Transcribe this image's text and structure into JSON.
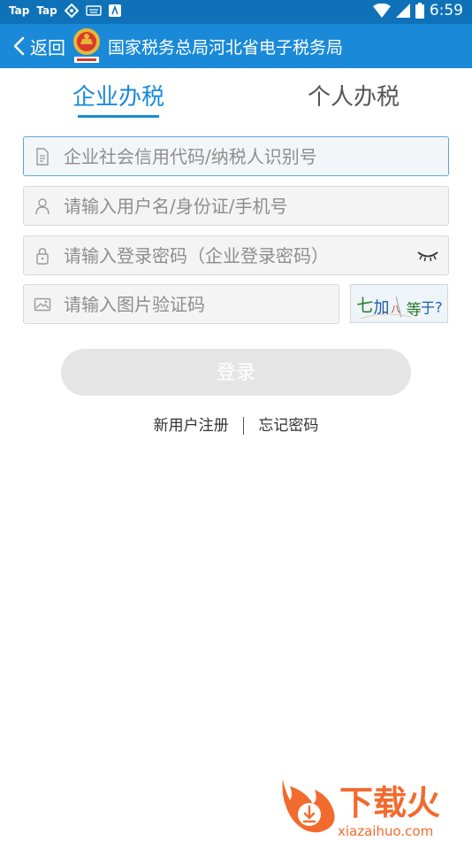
{
  "statusbar": {
    "left_labels": [
      "Tap",
      "Tap"
    ],
    "time": "6:59"
  },
  "header": {
    "back_label": "返回",
    "title": "国家税务总局河北省电子税务局",
    "emblem_caption": "中国税务"
  },
  "tabs": [
    {
      "label": "企业办税",
      "active": true
    },
    {
      "label": "个人办税",
      "active": false
    }
  ],
  "form": {
    "tax_id_placeholder": "企业社会信用代码/纳税人识别号",
    "username_placeholder": "请输入用户名/身份证/手机号",
    "password_placeholder": "请输入登录密码（企业登录密码）",
    "captcha_placeholder": "请输入图片验证码",
    "captcha_image_text": "七加八等于?"
  },
  "login_button": "登录",
  "links": {
    "register": "新用户注册",
    "forgot": "忘记密码"
  },
  "watermark": {
    "brand": "下载火",
    "url": "xiazaihuo.com"
  },
  "colors": {
    "header": "#1a8ad8",
    "statusbar": "#0f72b9",
    "accent": "#1a8ad8",
    "watermark": "#f26b2e"
  }
}
